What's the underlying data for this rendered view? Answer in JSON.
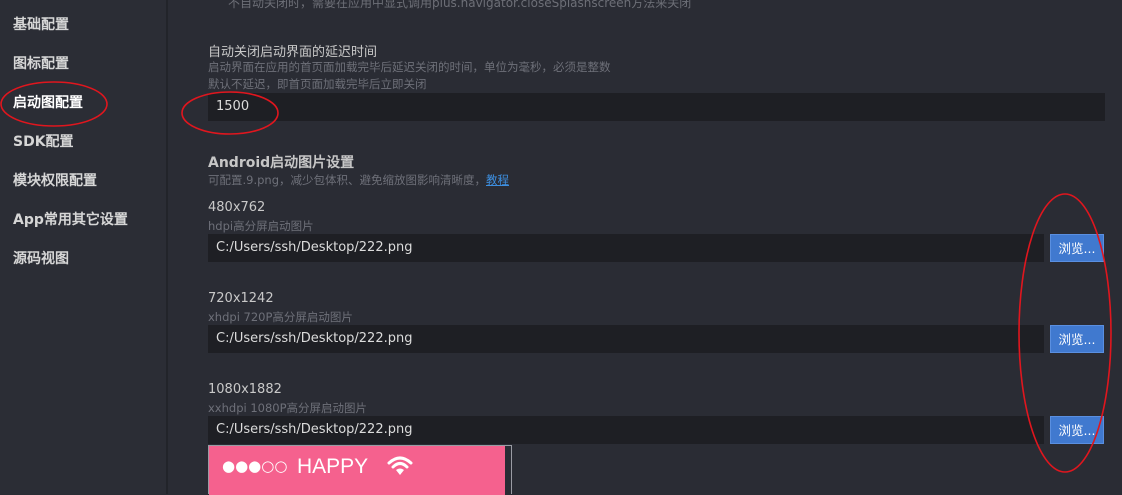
{
  "sidebar": {
    "items": [
      {
        "label": "基础配置"
      },
      {
        "label": "图标配置"
      },
      {
        "label": "启动图配置"
      },
      {
        "label": "SDK配置"
      },
      {
        "label": "模块权限配置"
      },
      {
        "label": "App常用其它设置"
      },
      {
        "label": "源码视图"
      }
    ],
    "active_index": 2
  },
  "main": {
    "top_cut_text": "不自动关闭时，需要在应用中显式调用plus.navigator.closeSplashscreen方法来关闭",
    "delay": {
      "label": "自动关闭启动界面的延迟时间",
      "desc_line1": "启动界面在应用的首页面加载完毕后延迟关闭的时间，单位为毫秒，必须是整数",
      "desc_line2": "默认不延迟，即首页面加载完毕后立即关闭",
      "value": "1500"
    },
    "android": {
      "title": "Android启动图片设置",
      "desc": "可配置.9.png，减少包体积、避免缩放图影响清晰度，",
      "link": "教程",
      "images": [
        {
          "size": "480x762",
          "desc": "hdpi高分屏启动图片",
          "path": "C:/Users/ssh/Desktop/222.png",
          "button": "浏览..."
        },
        {
          "size": "720x1242",
          "desc": "xhdpi 720P高分屏启动图片",
          "path": "C:/Users/ssh/Desktop/222.png",
          "button": "浏览..."
        },
        {
          "size": "1080x1882",
          "desc": "xxhdpi 1080P高分屏启动图片",
          "path": "C:/Users/ssh/Desktop/222.png",
          "button": "浏览..."
        }
      ]
    },
    "preview": {
      "dots": "●●●○○",
      "carrier": "HAPPY",
      "wifi_icon": "wifi-icon",
      "color": "#f5618e"
    }
  },
  "annotation_color": "#e0161e"
}
